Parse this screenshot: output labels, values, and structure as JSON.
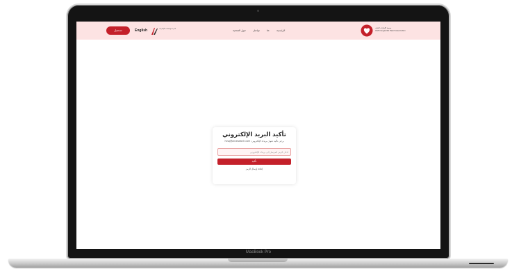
{
  "device": {
    "brand_label": "MacBook Pro"
  },
  "header": {
    "signin_label": "تسجيل",
    "language_label": "English",
    "partner_logo_text": "ادارة مؤسسات الإمارات",
    "nav": [
      "الرئيسية",
      "عنا",
      "تواصل",
      "حول الجمعية"
    ],
    "org_name_ar": "جمعية الإمارات للقلب",
    "org_name_en": "UAE Congenital Heart Association"
  },
  "card": {
    "title": "تأكيد البريد الإلكتروني",
    "subtitle": "يرجى تأكيد عنوان بريدك الإلكتروني: hcsq@ancesearch.com",
    "input_placeholder": "أدخل الرمز المرسل إلى بريدك الإلكتروني",
    "confirm_label": "تأكيد",
    "resend_label": "إعادة إرسال الرمز"
  },
  "colors": {
    "accent": "#c4202a",
    "header_bg": "#fde3e3"
  }
}
